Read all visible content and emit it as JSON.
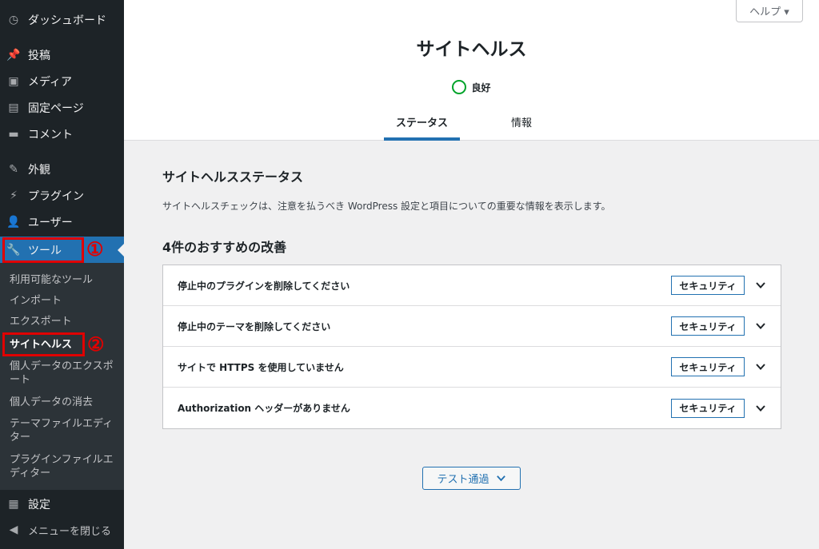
{
  "sidebar": {
    "items": [
      {
        "label": "ダッシュボード",
        "icon": "dashboard-icon"
      },
      {
        "label": "投稿",
        "icon": "pin-icon"
      },
      {
        "label": "メディア",
        "icon": "media-icon"
      },
      {
        "label": "固定ページ",
        "icon": "page-icon"
      },
      {
        "label": "コメント",
        "icon": "comment-icon"
      },
      {
        "label": "外観",
        "icon": "brush-icon"
      },
      {
        "label": "プラグイン",
        "icon": "plugin-icon"
      },
      {
        "label": "ユーザー",
        "icon": "user-icon"
      },
      {
        "label": "ツール",
        "icon": "wrench-icon"
      },
      {
        "label": "設定",
        "icon": "settings-icon"
      },
      {
        "label": "メニューを閉じる",
        "icon": "collapse-icon"
      }
    ],
    "submenu": [
      "利用可能なツール",
      "インポート",
      "エクスポート",
      "サイトヘルス",
      "個人データのエクスポート",
      "個人データの消去",
      "テーマファイルエディター",
      "プラグインファイルエディター"
    ],
    "marks": [
      "①",
      "②"
    ]
  },
  "header": {
    "help": "ヘルプ ▾",
    "title": "サイトヘルス",
    "status": "良好",
    "tabs": [
      "ステータス",
      "情報"
    ]
  },
  "main": {
    "section_title": "サイトヘルスステータス",
    "description": "サイトヘルスチェックは、注意を払うべき WordPress 設定と項目についての重要な情報を表示します。",
    "count_title": "4件のおすすめの改善",
    "issues": [
      {
        "label": "停止中のプラグインを削除してください",
        "badge": "セキュリティ"
      },
      {
        "label": "停止中のテーマを削除してください",
        "badge": "セキュリティ"
      },
      {
        "label": "サイトで HTTPS を使用していません",
        "badge": "セキュリティ"
      },
      {
        "label": "Authorization ヘッダーがありません",
        "badge": "セキュリティ"
      }
    ],
    "passed_button": "テスト通過"
  },
  "colors": {
    "accent": "#2271b1",
    "good": "#00a32a",
    "mark": "#e00000",
    "sidebar": "#1d2327"
  }
}
